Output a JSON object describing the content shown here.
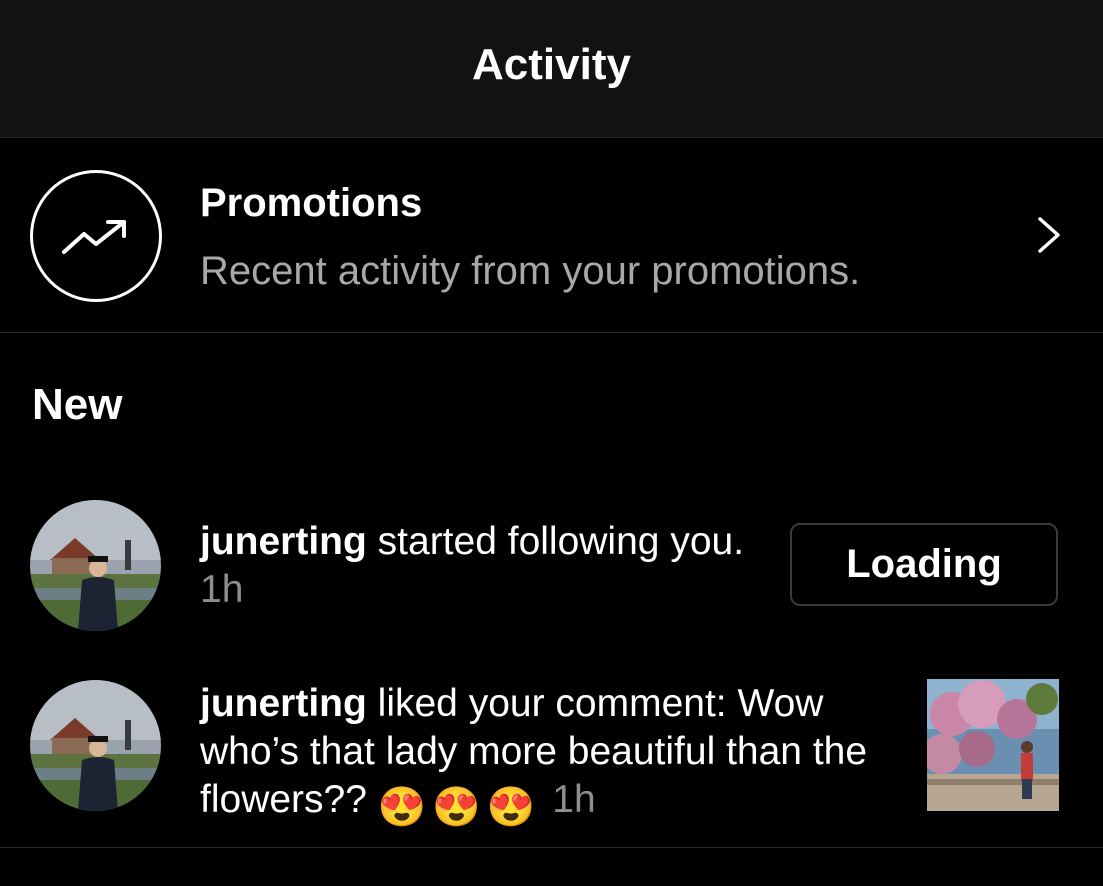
{
  "header": {
    "title": "Activity"
  },
  "promotions": {
    "title": "Promotions",
    "subtitle": "Recent activity from your promotions.",
    "icon": "trending-up-icon"
  },
  "section": {
    "label": "New"
  },
  "notifications": [
    {
      "username": "junerting",
      "text": " started following you.",
      "time": " 1h",
      "action_label": "Loading"
    },
    {
      "username": "junerting",
      "text": " liked your comment: Wow who’s that lady more beautiful than the flowers?? ",
      "emojis": [
        "😍",
        "😍",
        "😍"
      ],
      "time": " 1h"
    }
  ],
  "colors": {
    "background": "#000000",
    "header": "#121212",
    "muted_text": "#a8a8a8",
    "time_text": "#8e8e8e"
  }
}
